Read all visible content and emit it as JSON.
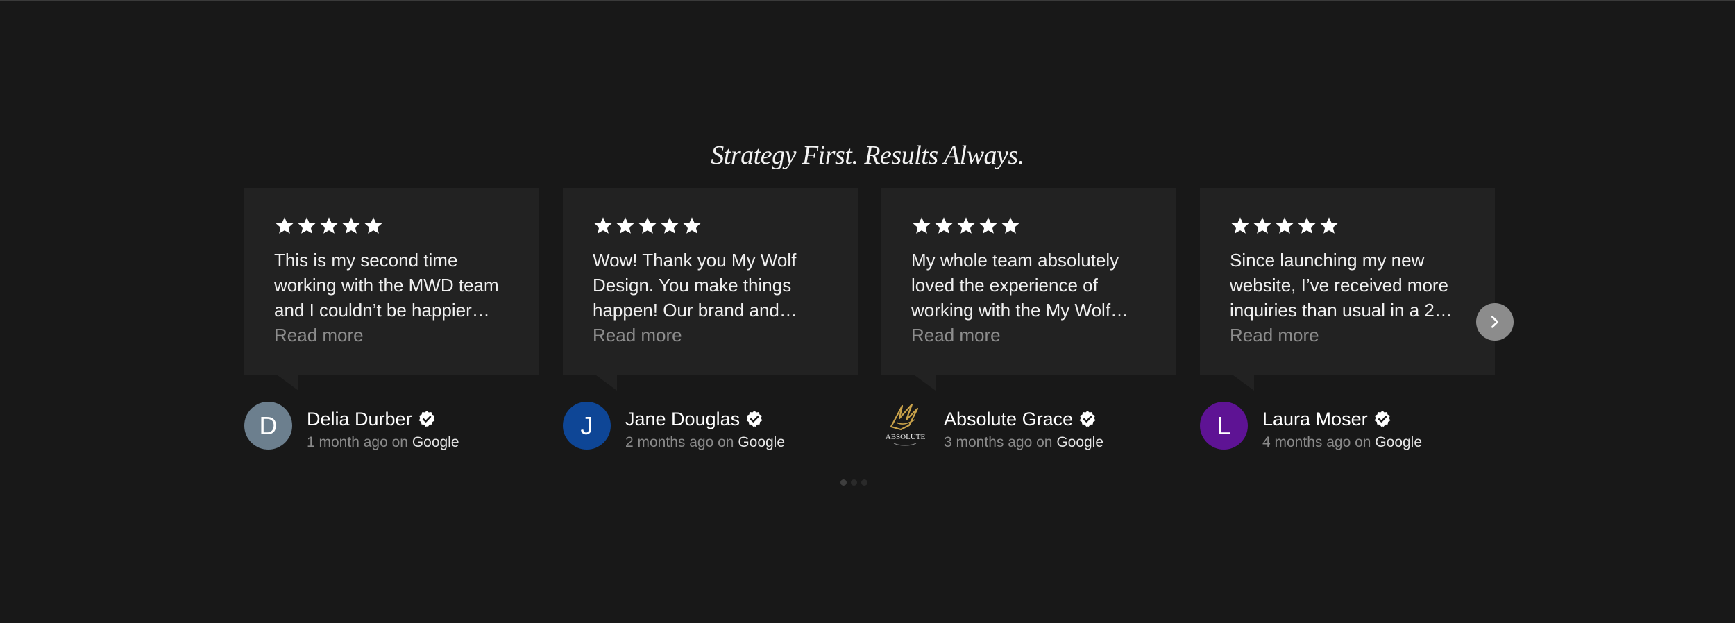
{
  "section": {
    "heading": "Strategy First. Results Always."
  },
  "rating_max": 5,
  "reviews": [
    {
      "rating": 5,
      "text": "This is my second time working with the MWD team and I couldn’t be happier wit…",
      "read_more": "Read more",
      "author": "Delia Durber",
      "avatar_letter": "D",
      "avatar_color": "#6c7f8e",
      "time": "1 month ago",
      "on": "on",
      "source": "Google"
    },
    {
      "rating": 5,
      "text": "Wow! Thank you My Wolf Design. You make things happen! Our brand and…",
      "read_more": "Read more",
      "author": "Jane Douglas",
      "avatar_letter": "J",
      "avatar_color": "#0e4696",
      "time": "2 months ago",
      "on": "on",
      "source": "Google"
    },
    {
      "rating": 5,
      "text": "My whole team absolutely loved the experience of working with the My Wolf…",
      "read_more": "Read more",
      "author": "Absolute Grace",
      "avatar_logo_text": "ABSOLUTE",
      "avatar_color": "#c9a24a",
      "time": "3 months ago",
      "on": "on",
      "source": "Google"
    },
    {
      "rating": 5,
      "text": "Since launching my new website, I’ve received more inquiries than usual in a 2…",
      "read_more": "Read more",
      "author": "Laura Moser",
      "avatar_letter": "L",
      "avatar_color": "#5e1394",
      "time": "4 months ago",
      "on": "on",
      "source": "Google"
    }
  ],
  "carousel": {
    "next_icon": "chevron-right-icon",
    "page_count": 3,
    "active_page": 1
  },
  "colors": {
    "background": "#181818",
    "card": "#222222",
    "star": "#ffffff",
    "muted_text": "#8d8d8d"
  }
}
